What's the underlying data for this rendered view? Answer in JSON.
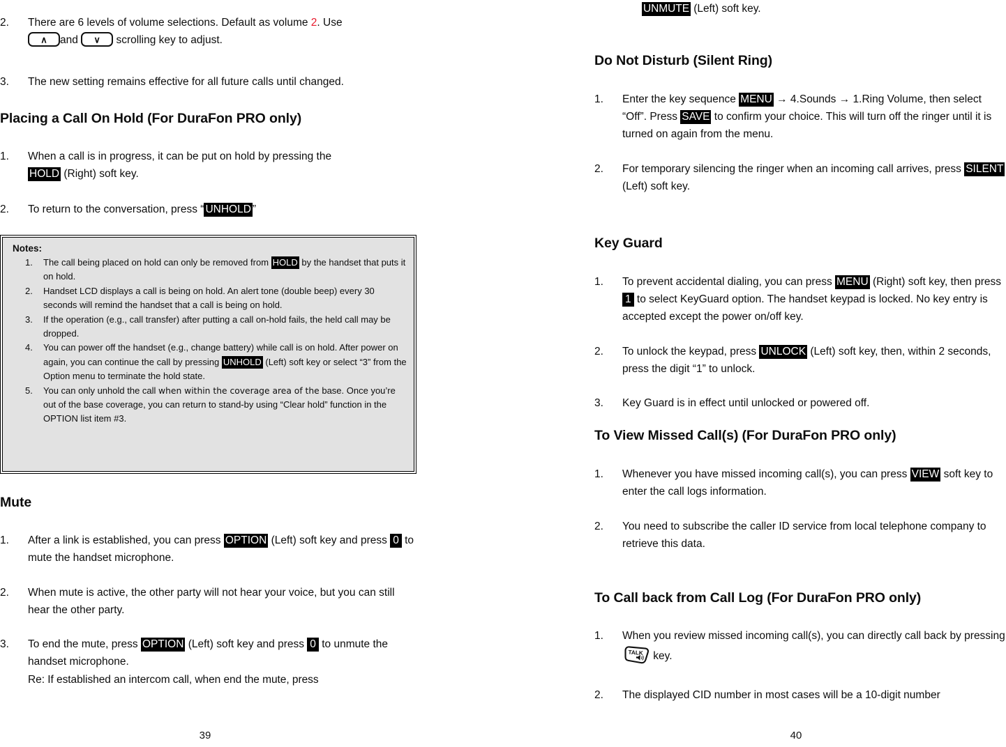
{
  "document": {
    "left_page": {
      "page_number": "39",
      "items": [
        {
          "num": "2.",
          "text_a": "There are 6 levels of volume selections.  Default as volume ",
          "highlight_red": "2",
          "text_b": ". Use ",
          "key_up": "∧",
          "text_c": "and ",
          "key_down": "∨",
          "text_d": " scrolling key to adjust."
        },
        {
          "num": "3.",
          "text_a": "The new setting remains effective for all future calls until changed."
        }
      ],
      "heading_hold": "Placing a Call On Hold (For DuraFon PRO only)",
      "hold_items": [
        {
          "num": "1.",
          "text_a": "When a call is in progress, it can be put on hold by pressing the ",
          "key": "HOLD",
          "text_b": " (Right) soft key."
        },
        {
          "num": "2.",
          "text_a": "To return to the conversation, press “",
          "key": "UNHOLD",
          "text_b": "”"
        }
      ],
      "notes": {
        "title": "Notes:",
        "items": [
          {
            "num": "1.",
            "text_a": "The call being placed on hold can only be removed from ",
            "key": "HOLD",
            "text_b": " by the handset that puts it on hold."
          },
          {
            "num": "2.",
            "text_a": "Handset LCD displays a call is being on hold.  An alert tone (double beep) every 30 seconds will remind the handset that a call is being on hold."
          },
          {
            "num": "3.",
            "text_a": "If the operation (e.g., call transfer) after putting a call on-hold fails, the held call may be dropped."
          },
          {
            "num": "4.",
            "text_a": "You can power off the handset (e.g., change battery) while call is on hold.  After power on again, you can continue the call by pressing ",
            "key": "UNHOLD",
            "text_b": " (Left) soft key or select “3” from the Option menu to terminate the hold state."
          },
          {
            "num": "5.",
            "text_a": "You can only unhold the call ",
            "text_alt": "when within the coverage area of the",
            "text_b": " base.  Once you’re out of the base coverage, you can return to stand-by using “Clear hold” function in the OPTION list item #3."
          }
        ]
      },
      "heading_mute": "Mute",
      "mute_items": [
        {
          "num": "1.",
          "text_a": "After a link is established, you can press ",
          "key": "OPTION",
          "text_b": " (Left) soft key and press ",
          "key2": "0",
          "text_c": " to mute the handset microphone."
        },
        {
          "num": "2.",
          "text_a": "When mute is active, the other party will not hear your voice, but you can still hear the other party."
        },
        {
          "num": "3.",
          "text_a": "To end the mute, press ",
          "key": "OPTION",
          "text_b": " (Left) soft key and press ",
          "key2": "0",
          "text_c": " to unmute the handset microphone."
        }
      ],
      "mute_note": "Re: If established an intercom call, when end the mute, press"
    },
    "right_page": {
      "page_number": "40",
      "continuation": {
        "key": "UNMUTE",
        "text_b": " (Left) soft key."
      },
      "heading_dnd": "Do Not Disturb (Silent Ring)",
      "dnd_items": [
        {
          "num": "1.",
          "text_a": "Enter the key sequence ",
          "key": "MENU",
          "text_b": " → 4.Sounds → 1.Ring Volume, then select “Off”.  Press ",
          "key2": "SAVE",
          "text_c": " to confirm your choice. This will turn off the ringer until it is turned on again from the menu."
        },
        {
          "num": "2.",
          "text_a": "For temporary silencing the ringer when an incoming call arrives, press ",
          "key": "SILENT",
          "text_b": " (Left) soft key."
        }
      ],
      "heading_keyguard": "Key Guard",
      "keyguard_items": [
        {
          "num": "1.",
          "text_a": "To prevent accidental dialing, you can press ",
          "key": "MENU",
          "text_b": " (Right) soft key, then press ",
          "key2": "1",
          "text_c": " to select KeyGuard option.  The handset keypad is locked.  No key entry is accepted except the power on/off key."
        },
        {
          "num": "2.",
          "text_a": "To unlock the keypad, press ",
          "key": "UNLOCK",
          "text_b": " (Left) soft key, then, within 2 seconds, press the digit “1” to unlock."
        },
        {
          "num": "3.",
          "text_a": "Key Guard is in effect until unlocked or powered off."
        }
      ],
      "heading_missed": "To View Missed Call(s) (For DuraFon PRO only)",
      "missed_items": [
        {
          "num": "1.",
          "text_a": "Whenever you have missed incoming call(s), you can press ",
          "key": "VIEW",
          "text_b": " soft key to enter the call logs information."
        },
        {
          "num": "2.",
          "text_a": "You need to subscribe the caller ID service from local telephone company to retrieve this data."
        }
      ],
      "heading_callback": "To Call back from Call Log (For DuraFon PRO only)",
      "callback_items": [
        {
          "num": "1.",
          "text_a": "When you review missed incoming call(s), you can directly call back by pressing ",
          "talk_key_label": "TALK",
          "text_b": " key."
        },
        {
          "num": "2.",
          "text_a": "The displayed CID number in most cases will be a 10-digit number"
        }
      ]
    }
  },
  "colors": {
    "highlight_bg": "#000000",
    "highlight_fg": "#ffffff",
    "accent_red": "#e8192c",
    "notes_bg": "#e2e2e2"
  }
}
